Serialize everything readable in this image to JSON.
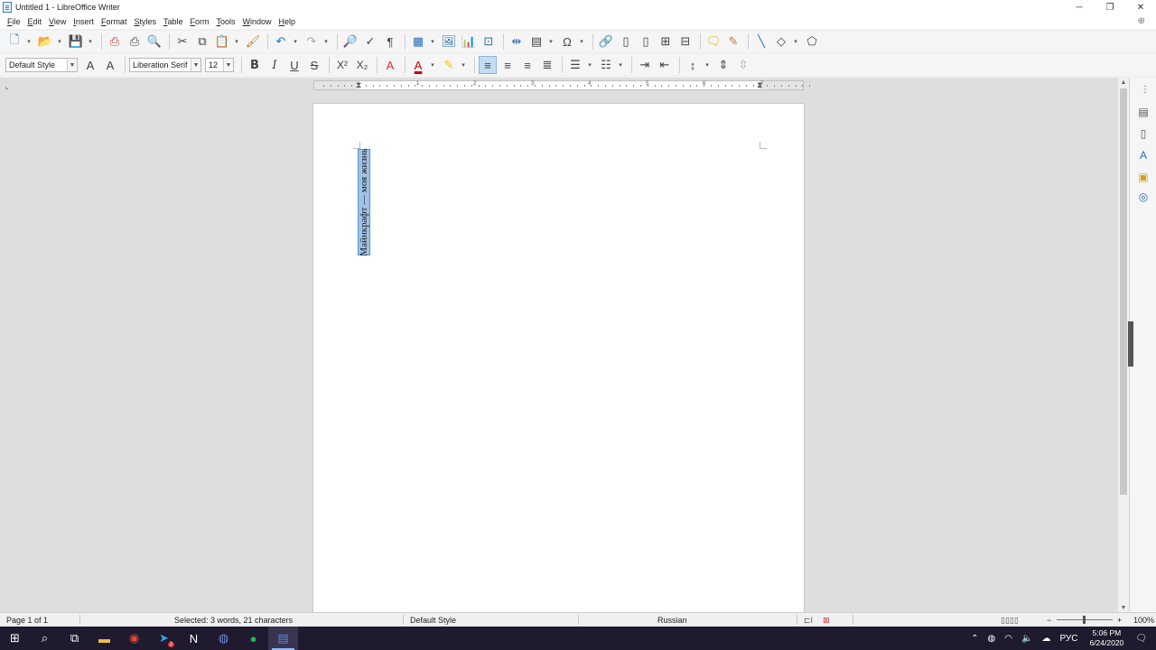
{
  "window": {
    "title": "Untitled 1 - LibreOffice Writer",
    "controls": [
      "─",
      "❐",
      "✕"
    ]
  },
  "menubar": {
    "items": [
      {
        "u": "F",
        "rest": "ile"
      },
      {
        "u": "E",
        "rest": "dit"
      },
      {
        "u": "V",
        "rest": "iew"
      },
      {
        "u": "I",
        "rest": "nsert"
      },
      {
        "u": "F",
        "rest": "ormat"
      },
      {
        "u": "S",
        "rest": "tyles"
      },
      {
        "u": "T",
        "rest": "able"
      },
      {
        "u": "F",
        "rest": "orm"
      },
      {
        "u": "T",
        "rest": "ools"
      },
      {
        "u": "W",
        "rest": "indow"
      },
      {
        "u": "H",
        "rest": "elp"
      }
    ]
  },
  "formatting": {
    "paragraph_style": "Default Style",
    "font_name": "Liberation Serif",
    "font_size": "12",
    "bold": "B",
    "italic": "I",
    "underline": "U",
    "strike": "S",
    "superscript": "X²",
    "subscript": "X₂"
  },
  "ruler": {
    "numbers": [
      "1",
      "2",
      "3",
      "4",
      "5",
      "6",
      "7"
    ]
  },
  "document": {
    "vertical_text": "Майнкрафт — моя жизнь"
  },
  "status": {
    "page": "Page 1 of 1",
    "selection": "Selected: 3 words, 21 characters",
    "page_style": "Default Style",
    "language": "Russian",
    "zoom": "100%"
  },
  "taskbar": {
    "clock_time": "5:06 PM",
    "clock_date": "6/24/2020",
    "lang": "РУС",
    "notification_badge": "2",
    "colors": {
      "background": "#1f1a2e",
      "accent": "#8fb8ff"
    }
  }
}
